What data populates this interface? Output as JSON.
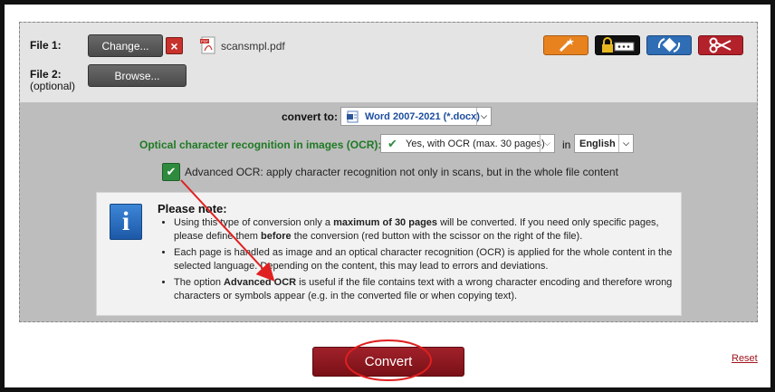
{
  "file1": {
    "label": "File 1:",
    "change_label": "Change...",
    "delete_icon": "×",
    "filename": "scansmpl.pdf"
  },
  "file2": {
    "label": "File 2:",
    "optional": "(optional)",
    "browse_label": "Browse..."
  },
  "tools": [
    {
      "icon": "magic-wand-icon",
      "color": "#e8821f"
    },
    {
      "icon": "password-lock-icon",
      "color": "#1a1a1a"
    },
    {
      "icon": "rotate-icon",
      "color": "#2f6db5"
    },
    {
      "icon": "scissors-icon",
      "color": "#b3212b"
    }
  ],
  "convert_to": {
    "label": "convert to:",
    "value": "Word 2007-2021 (*.docx)"
  },
  "ocr": {
    "label": "Optical character recognition in images (OCR):",
    "value": "Yes, with OCR (max. 30 pages)",
    "in_label": "in",
    "language": "English"
  },
  "advanced_ocr": {
    "label": "Advanced OCR: apply character recognition not only in scans, but in the whole file content",
    "checked": true
  },
  "note": {
    "title": "Please note:",
    "items": [
      {
        "pre": "Using this type of conversion only a ",
        "b1": "maximum of 30 pages",
        "mid": " will be converted. If you need only specific pages, please define them ",
        "b2": "before",
        "post": " the conversion (red button with the scissor on the right of the file)."
      },
      {
        "pre": "Each page is handled as image and an optical character recognition (OCR) is applied for the whole content in the selected language. Depending on the content, this may lead to errors and deviations.",
        "b1": "",
        "mid": "",
        "b2": "",
        "post": ""
      },
      {
        "pre": "The option ",
        "b1": "Advanced OCR",
        "mid": " is useful if the file contains text with a wrong character encoding and therefore wrong characters or symbols appear (e.g. in the converted file or when copying text).",
        "b2": "",
        "post": ""
      }
    ]
  },
  "convert_button": "Convert",
  "reset_link": "Reset",
  "colors": {
    "accent_red": "#8f1a22",
    "ocr_green": "#1f7a24",
    "annotation_red": "#e02020"
  }
}
